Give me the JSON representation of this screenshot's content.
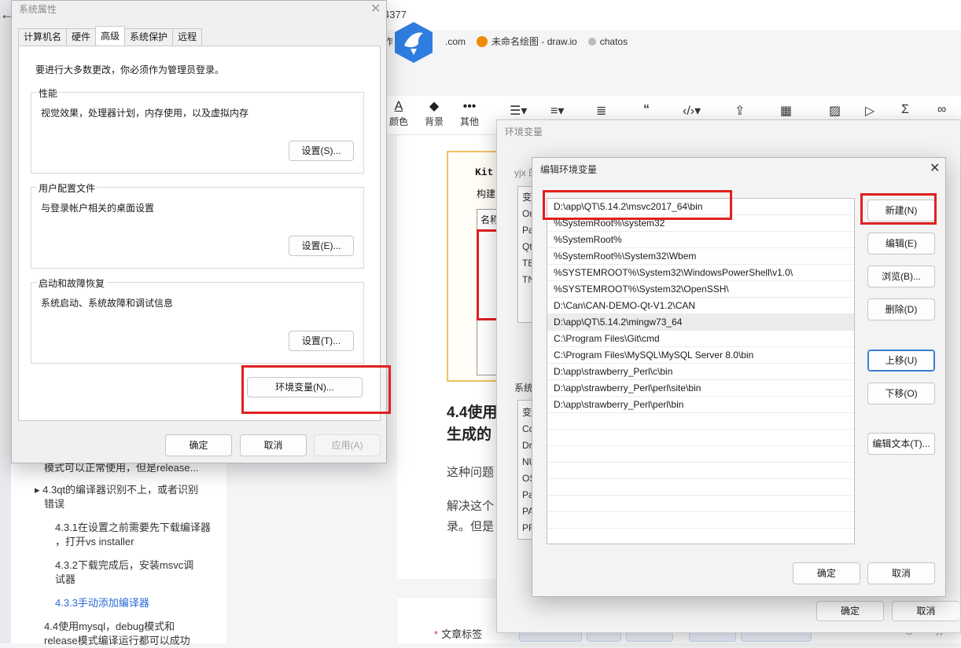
{
  "browser": {
    "address_fragment": "4377",
    "bookmarks": [
      {
        "label": ".com"
      },
      {
        "label": "未命名绘图 - draw.io"
      },
      {
        "label": "chatos"
      }
    ],
    "partial_label": "作"
  },
  "editor_toolbar": {
    "items": [
      {
        "label": "颜色",
        "icon": "A"
      },
      {
        "label": "背景",
        "icon": "◆"
      },
      {
        "label": "其他",
        "icon": "•••"
      }
    ]
  },
  "article": {
    "kit_text": "Kit",
    "build_text": "构建",
    "name_text": "名称",
    "heading_lines": [
      "4.4使用",
      "生成的"
    ],
    "para1": "这种问题",
    "para2_lines": [
      "解决这个",
      "录。但是"
    ],
    "tag_label": "文章标签"
  },
  "outline": {
    "items": [
      {
        "text": "模式可以正常使用，但是release..."
      },
      {
        "text": "4.3qt的编译器识别不上，或者识别"
      },
      {
        "text": "错误"
      },
      {
        "text": "4.3.1在设置之前需要先下载编译器"
      },
      {
        "text": "，打开vs installer"
      },
      {
        "text": "4.3.2下载完成后，安装msvc调"
      },
      {
        "text": "试器"
      },
      {
        "text": "4.3.3手动添加编译器"
      },
      {
        "text": "4.4使用mysql，debug模式和"
      },
      {
        "text": "release模式编译运行都可以成功"
      }
    ]
  },
  "watermark": "CSDN @Cassyjx",
  "env_window": {
    "title": "环境变量",
    "user_vars_label": "yjx 的",
    "user_rows": [
      "变",
      "On",
      "Pa",
      "Qt",
      "TE",
      "TN"
    ],
    "sys_label": "系统",
    "sys_rows": [
      "变",
      "Co",
      "Dr",
      "NU",
      "OS",
      "Pa",
      "PA",
      "PR"
    ],
    "ok": "确定",
    "cancel": "取消"
  },
  "edit_dialog": {
    "title": "编辑环境变量",
    "paths": [
      "D:\\app\\QT\\5.14.2\\msvc2017_64\\bin",
      "%SystemRoot%\\system32",
      "%SystemRoot%",
      "%SystemRoot%\\System32\\Wbem",
      "%SYSTEMROOT%\\System32\\WindowsPowerShell\\v1.0\\",
      "%SYSTEMROOT%\\System32\\OpenSSH\\",
      "D:\\Can\\CAN-DEMO-Qt-V1.2\\CAN",
      "D:\\app\\QT\\5.14.2\\mingw73_64",
      "C:\\Program Files\\Git\\cmd",
      "C:\\Program Files\\MySQL\\MySQL Server 8.0\\bin",
      "D:\\app\\strawberry_Perl\\c\\bin",
      "D:\\app\\strawberry_Perl\\perl\\site\\bin",
      "D:\\app\\strawberry_Perl\\perl\\bin"
    ],
    "buttons": {
      "new": "新建(N)",
      "edit": "编辑(E)",
      "browse": "浏览(B)...",
      "delete": "删除(D)",
      "move_up": "上移(U)",
      "move_down": "下移(O)",
      "edit_text": "编辑文本(T)..."
    },
    "ok": "确定",
    "cancel": "取消"
  },
  "system_properties": {
    "title": "系统属性",
    "tabs": [
      "计算机名",
      "硬件",
      "高级",
      "系统保护",
      "远程"
    ],
    "active_tab": "高级",
    "admin_note": "要进行大多数更改，你必须作为管理员登录。",
    "groups": [
      {
        "title": "性能",
        "desc": "视觉效果，处理器计划，内存使用，以及虚拟内存",
        "button": "设置(S)..."
      },
      {
        "title": "用户配置文件",
        "desc": "与登录帐户相关的桌面设置",
        "button": "设置(E)..."
      },
      {
        "title": "启动和故障恢复",
        "desc": "系统启动、系统故障和调试信息",
        "button": "设置(T)..."
      }
    ],
    "env_button": "环境变量(N)...",
    "ok": "确定",
    "cancel": "取消",
    "apply": "应用(A)"
  },
  "colors": {
    "highlight_red": "#e02020",
    "focus_blue": "#3a7bd5",
    "link_blue": "#2a6ad8"
  }
}
